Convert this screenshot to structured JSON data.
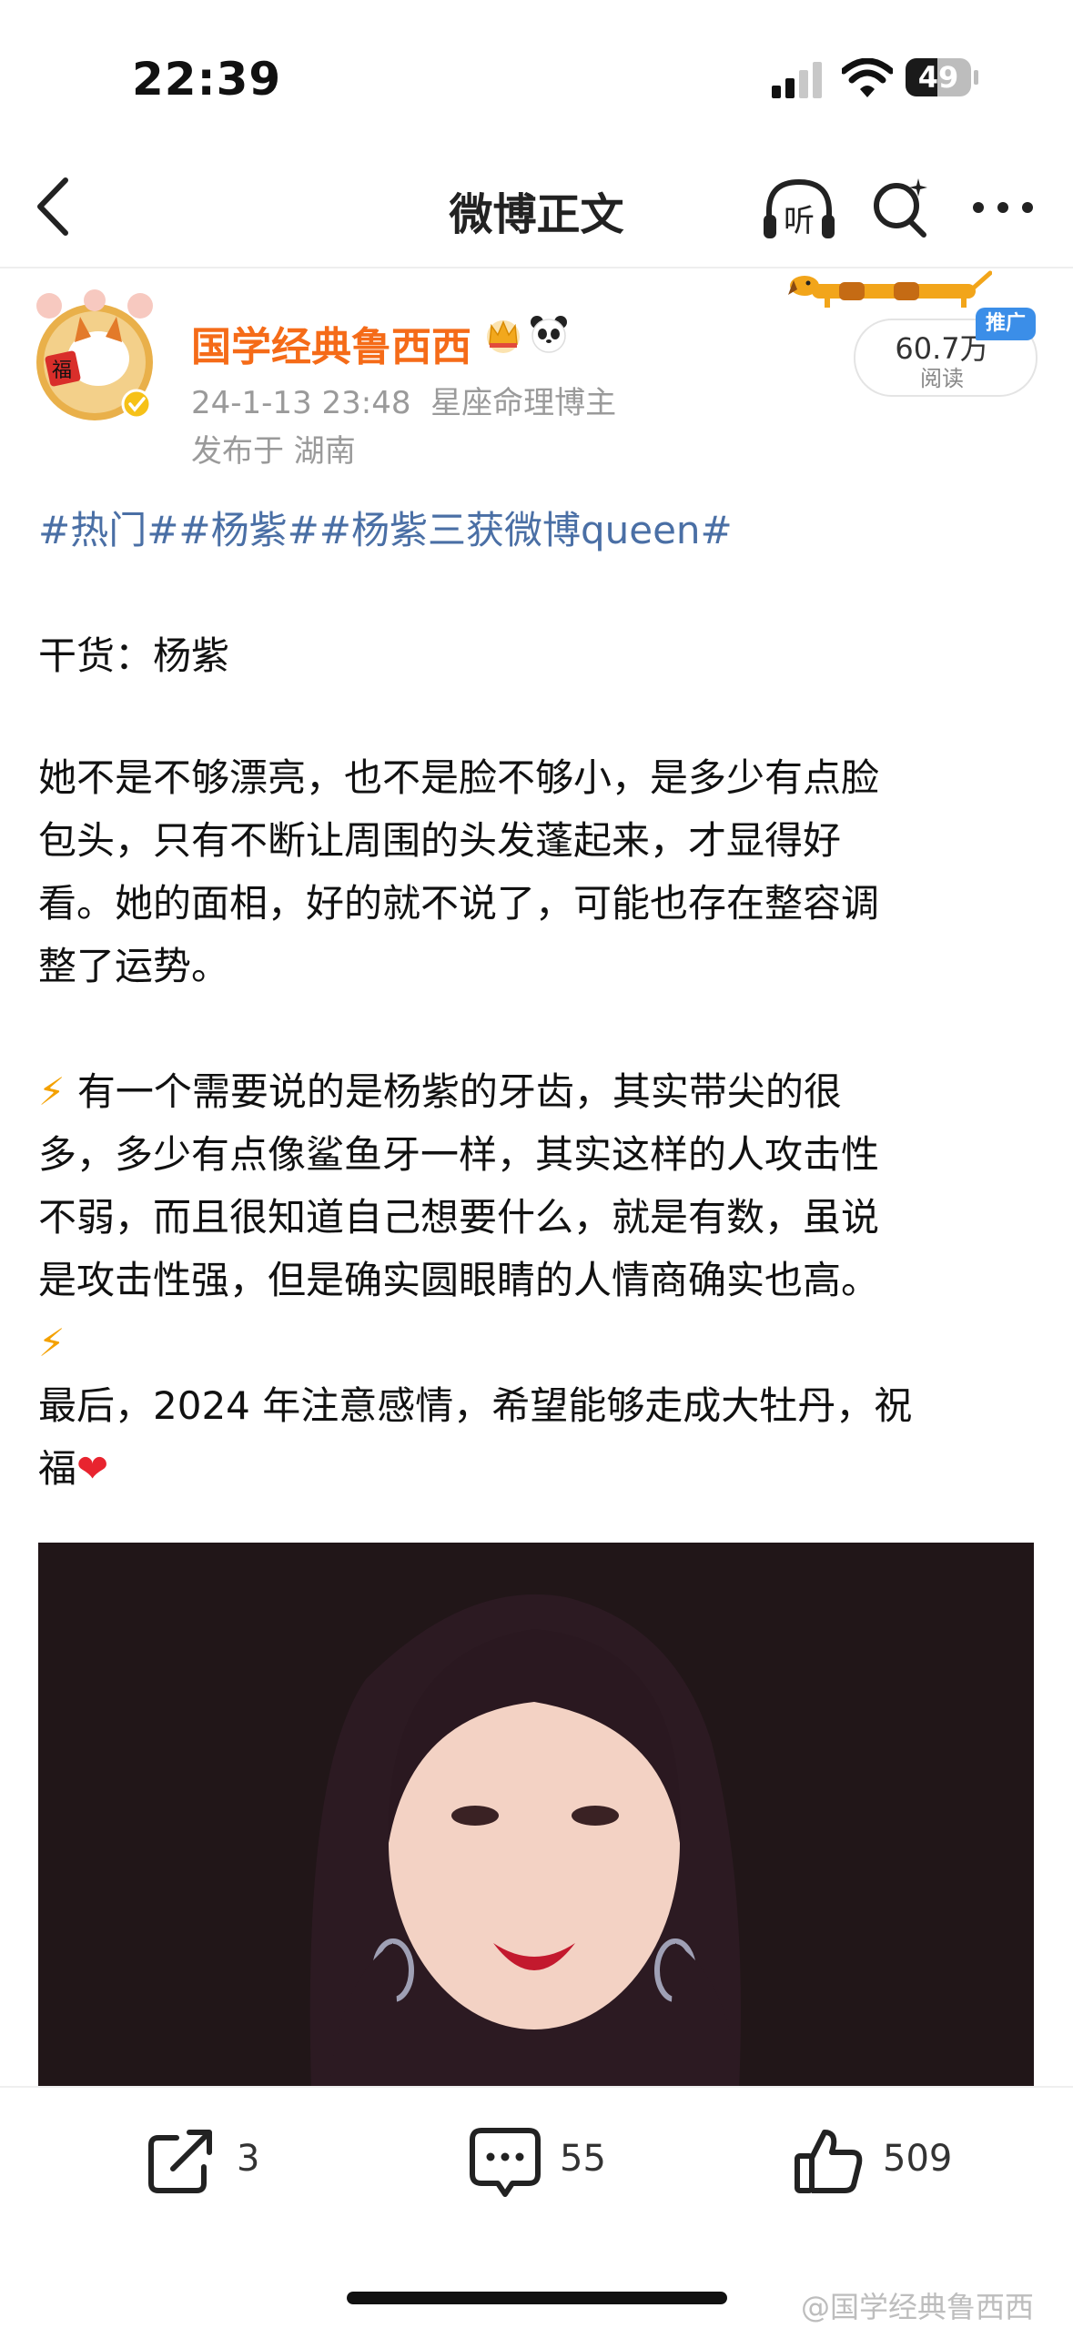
{
  "status_bar": {
    "time": "22:39",
    "battery": "49",
    "battery_level": 0.49
  },
  "nav": {
    "title": "微博正文",
    "listen_label": "听"
  },
  "author": {
    "name": "国学经典鲁西西",
    "datetime": "24-1-13 23:48",
    "tag": "星座命理博主",
    "location": "发布于 湖南",
    "badges": [
      "crown-emoji",
      "panda-emoji"
    ]
  },
  "reads": {
    "count": "60.7万",
    "label": "阅读",
    "promo": "推广"
  },
  "post": {
    "tags": "#热门##杨紫##杨紫三获微博queen#",
    "line1": "干货：杨紫",
    "para1": [
      "她不是不够漂亮，也不是脸不够小，是多少有点脸",
      "包头，只有不断让周围的头发蓬起来，才显得好",
      "看。她的面相，好的就不说了，可能也存在整容调",
      "整了运势。"
    ],
    "para2_bolt": "⚡",
    "para2": [
      "有一个需要说的是杨紫的牙齿，其实带尖的很",
      "多，多少有点像鲨鱼牙一样，其实这样的人攻击性",
      "不弱，而且很知道自己想要什么，就是有数，虽说",
      "是攻击性强，但是确实圆眼睛的人情商确实也高。"
    ],
    "bolt2": "⚡",
    "para3": [
      "最后，2024 年注意感情，希望能够走成大牡丹，祝"
    ],
    "para3_last": "福",
    "heart": "❤"
  },
  "actions": {
    "share_count": "3",
    "comment_count": "55",
    "like_count": "509"
  },
  "watermark": "@国学经典鲁西西",
  "colors": {
    "author": "#f56b18",
    "link": "#4a6fa5",
    "promo": "#3b8ee8"
  }
}
